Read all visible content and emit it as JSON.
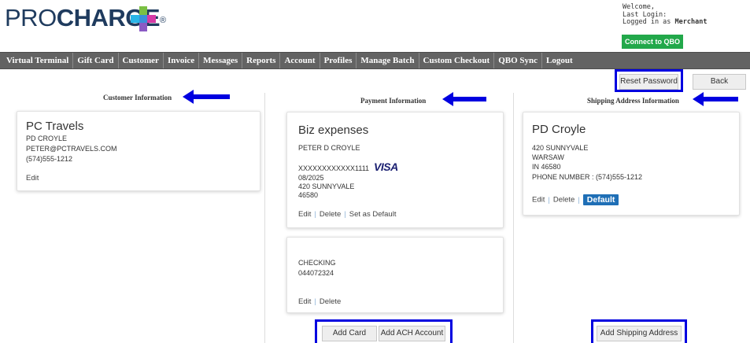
{
  "header": {
    "logo_pro": "PRO",
    "logo_charge": "CHARGE",
    "logo_reg": "®",
    "welcome_line1": "Welcome,",
    "welcome_line2": "Last Login:",
    "welcome_line3_prefix": "Logged in as",
    "welcome_user": "Merchant",
    "qbo_button": "Connect to QBO"
  },
  "nav": {
    "items": [
      "Virtual Terminal",
      "Gift Card",
      "Customer",
      "Invoice",
      "Messages",
      "Reports",
      "Account",
      "Profiles",
      "Manage Batch",
      "Custom Checkout",
      "QBO Sync",
      "Logout"
    ]
  },
  "toolbar": {
    "reset_password": "Reset Password",
    "back": "Back"
  },
  "customer": {
    "section_title": "Customer Information",
    "name": "PC Travels",
    "contact": "PD CROYLE",
    "email": "PETER@PCTRAVELS.COM",
    "phone": "(574)555-1212",
    "edit": "Edit"
  },
  "payment": {
    "section_title": "Payment Information",
    "card": {
      "title": "Biz expenses",
      "holder": "PETER D CROYLE",
      "number": "XXXXXXXXXXXX1111",
      "brand": "VISA",
      "expiry": "08/2025",
      "address": "420 SUNNYVALE",
      "zip": "46580",
      "edit": "Edit",
      "delete": "Delete",
      "set_default": "Set as Default"
    },
    "ach": {
      "type": "CHECKING",
      "routing": "044072324",
      "edit": "Edit",
      "delete": "Delete"
    },
    "add_card": "Add Card",
    "add_ach": "Add ACH Account"
  },
  "shipping": {
    "section_title": "Shipping Address Information",
    "name": "PD Croyle",
    "address": "420 SUNNYVALE",
    "city": "WARSAW",
    "state_zip": "IN 46580",
    "phone": "PHONE NUMBER : (574)555-1212",
    "edit": "Edit",
    "delete": "Delete",
    "default_badge": "Default",
    "add_button": "Add Shipping Address"
  },
  "colors": {
    "annotation_blue": "#0000e0",
    "nav_bg": "#636363",
    "qbo_green": "#22a84a",
    "visa_blue": "#1a1f71",
    "default_badge": "#1f6fb6"
  }
}
